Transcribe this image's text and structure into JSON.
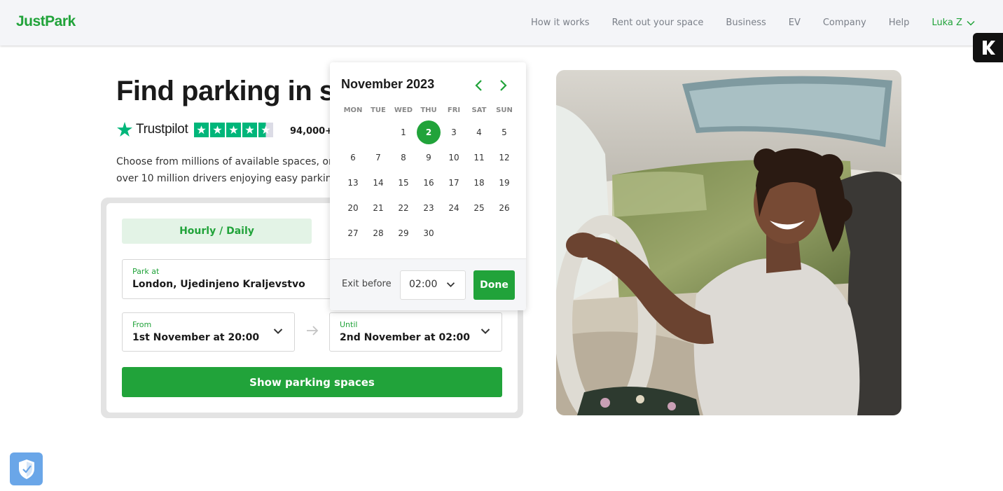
{
  "brand": {
    "logo": "JustPark",
    "accent": "#21a33a"
  },
  "nav": {
    "links": [
      "How it works",
      "Rent out your space",
      "Business",
      "EV",
      "Company",
      "Help"
    ],
    "user": "Luka Z"
  },
  "hero": {
    "title": "Find parking in s",
    "trustpilot": "Trustpilot",
    "rating_stars": 4.5,
    "reviews": "94,000+ r",
    "desc_line1": "Choose from millions of available spaces, or re",
    "desc_line2": "over 10 million drivers enjoying easy parking."
  },
  "search": {
    "tab_hourly": "Hourly / Daily",
    "park_at_label": "Park at",
    "park_at_value": "London, Ujedinjeno Kraljevstvo",
    "from_label": "From",
    "from_value": "1st November at 20:00",
    "until_label": "Until",
    "until_value": "2nd November at 02:00",
    "show_button": "Show parking spaces"
  },
  "calendar": {
    "title": "November 2023",
    "weekdays": [
      "MON",
      "TUE",
      "WED",
      "THU",
      "FRI",
      "SAT",
      "SUN"
    ],
    "leading_blanks": 2,
    "days": 30,
    "selected_day": 2,
    "exit_label": "Exit before",
    "exit_time": "02:00",
    "done_label": "Done"
  }
}
